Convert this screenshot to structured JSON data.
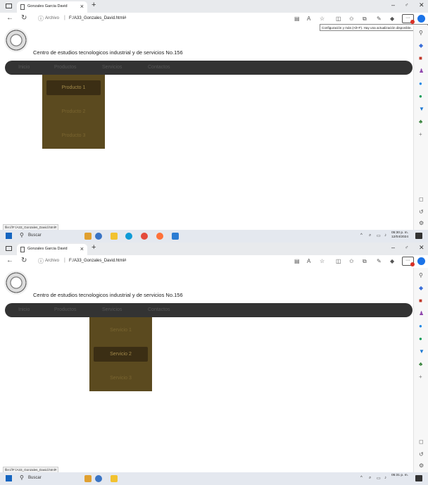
{
  "shots": [
    {
      "browser": {
        "tab_title": "Gonzales Garcia David",
        "tab_close": "×",
        "new_tab": "+",
        "url_scheme": "Archivo",
        "url_sep": "|",
        "url_path": "F:/A33_Gonzales_David.html#",
        "minimize": "–",
        "maximize": "♂",
        "close": "✕",
        "more_label": "···",
        "tooltip": "Configuración y más (Alt+F). Hay una actualización disponible."
      },
      "site": {
        "school_name": "Centro de estudios tecnologicos industrial y de servicios No.156",
        "nav": [
          "Inicio",
          "Productos",
          "Servicios",
          "Contactos"
        ]
      },
      "dropdown": {
        "items": [
          "Producto 1",
          "Producto 2",
          "Producto 3"
        ],
        "active_index": 0
      },
      "status_url": "file:///F:/A33_Gonzales_David.html#",
      "taskbar": {
        "search": "Buscar",
        "time": "05:30 p. m.",
        "date": "12/04/2024"
      }
    },
    {
      "browser": {
        "tab_title": "Gonzales Garcia David",
        "tab_close": "×",
        "new_tab": "+",
        "url_scheme": "Archivo",
        "url_sep": "|",
        "url_path": "F:/A33_Gonzales_David.html#",
        "minimize": "–",
        "maximize": "♂",
        "close": "✕",
        "more_label": "···",
        "tooltip": ""
      },
      "site": {
        "school_name": "Centro de estudios tecnologicos industrial y de servicios No.156",
        "nav": [
          "Inicio",
          "Productos",
          "Servicios",
          "Contactos"
        ]
      },
      "dropdown": {
        "items": [
          "Servicio 1",
          "Servicio 2",
          "Servicio 3"
        ],
        "active_index": 1
      },
      "status_url": "file:///F:/A33_Gonzales_David.html#",
      "taskbar": {
        "search": "Buscar",
        "time": "05:31 p. m.",
        "date": ""
      }
    }
  ],
  "colors": {
    "navbar": "#333333",
    "dropdown": "#5b4a1f",
    "dropdown_active": "#3b2e14"
  }
}
